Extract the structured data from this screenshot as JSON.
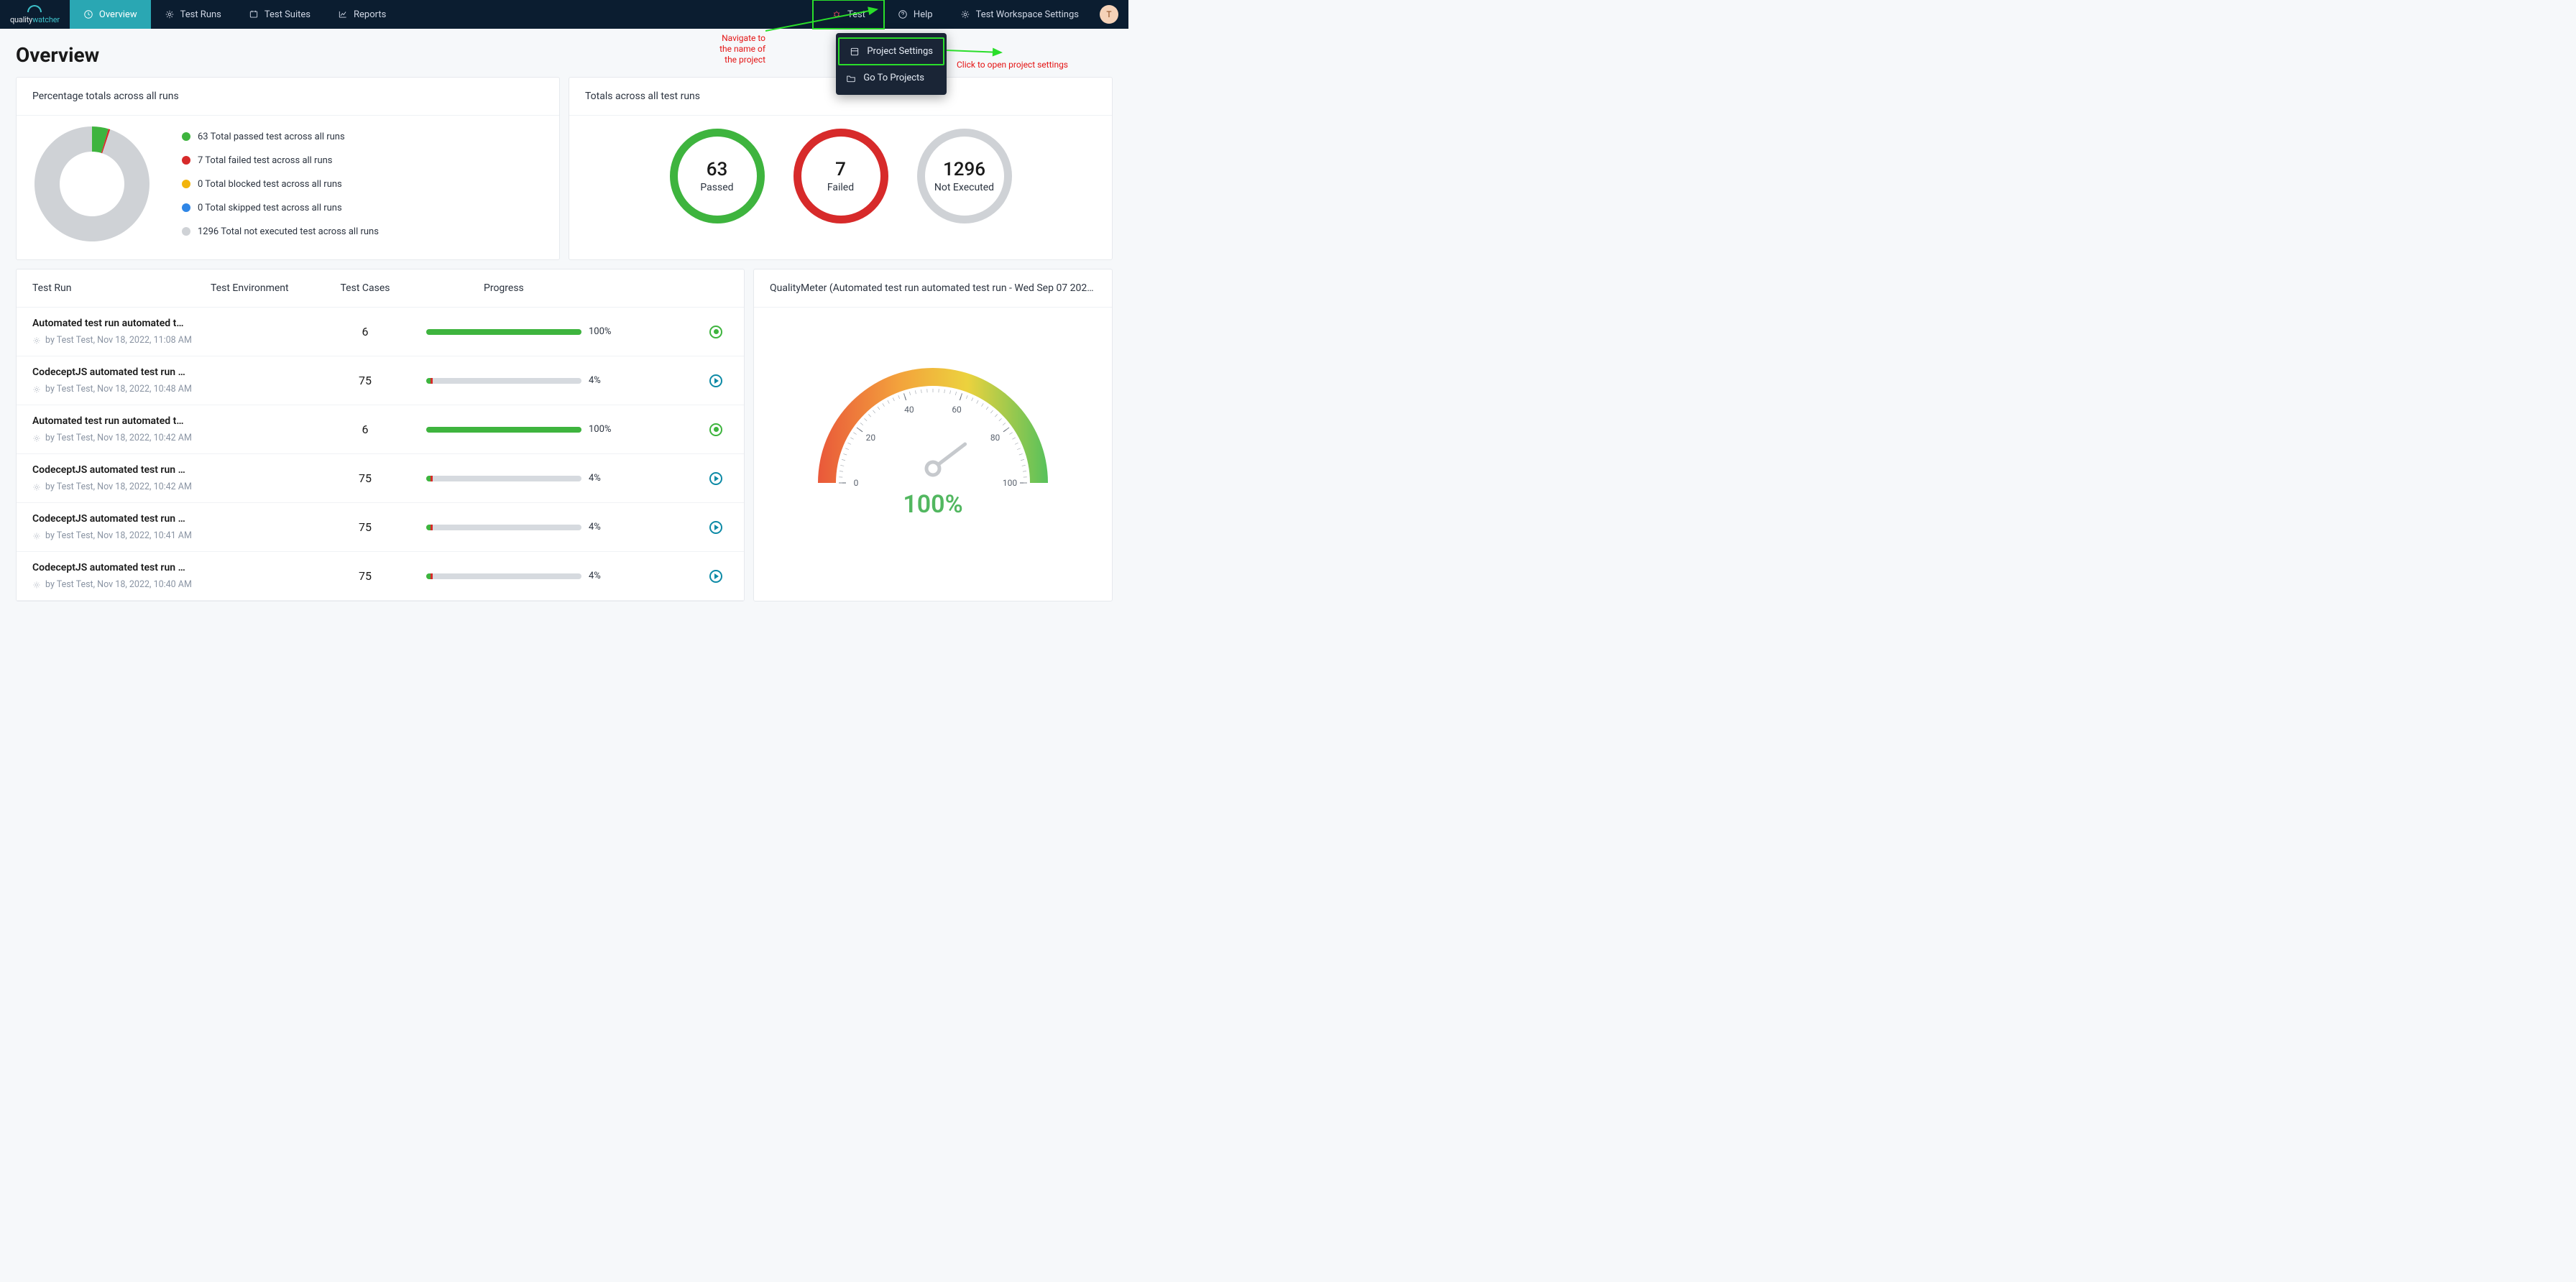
{
  "brand": {
    "name1": "quality",
    "name2": "watcher"
  },
  "nav": {
    "overview": "Overview",
    "runs": "Test Runs",
    "suites": "Test Suites",
    "reports": "Reports",
    "project": "Test",
    "help": "Help",
    "workspace": "Test Workspace Settings",
    "avatar_initial": "T"
  },
  "dropdown": {
    "project_settings": "Project Settings",
    "go_to_projects": "Go To Projects"
  },
  "annotations": {
    "left": "Navigate to\nthe name of\nthe project",
    "right": "Click to open project settings"
  },
  "page_title": "Overview",
  "percent_card": {
    "title": "Percentage totals across all runs"
  },
  "totals_card": {
    "title": "Totals across all test runs"
  },
  "chart_data": {
    "donut": {
      "type": "pie",
      "title": "Percentage totals across all runs",
      "series": [
        {
          "name": "passed",
          "value": 63,
          "color": "#3eb43e",
          "label": "63 Total passed test across all runs"
        },
        {
          "name": "failed",
          "value": 7,
          "color": "#d72a2a",
          "label": "7 Total failed test across all runs"
        },
        {
          "name": "blocked",
          "value": 0,
          "color": "#f2b40c",
          "label": "0 Total blocked test across all runs"
        },
        {
          "name": "skipped",
          "value": 0,
          "color": "#2f86e6",
          "label": "0 Total skipped test across all runs"
        },
        {
          "name": "not_executed",
          "value": 1296,
          "color": "#cfd2d6",
          "label": "1296 Total not executed test across all runs"
        }
      ]
    },
    "totals": [
      {
        "value": 63,
        "label": "Passed",
        "color": "#3eb43e"
      },
      {
        "value": 7,
        "label": "Failed",
        "color": "#d72a2a"
      },
      {
        "value": 1296,
        "label": "Not Executed",
        "color": "#cfd2d6"
      }
    ],
    "gauge": {
      "type": "gauge",
      "value": 100,
      "display": "100%",
      "min": 0,
      "max": 100,
      "ticks": [
        0,
        20,
        40,
        60,
        80,
        100
      ],
      "title": "QualityMeter (Automated test run automated test run - Wed Sep 07 202…"
    }
  },
  "table": {
    "cols": {
      "run": "Test Run",
      "env": "Test Environment",
      "cases": "Test Cases",
      "prog": "Progress"
    },
    "rows": [
      {
        "title": "Automated test run automated test …",
        "meta": "by Test Test, Nov 18, 2022, 11:08 AM",
        "cases": 6,
        "progress": 100,
        "pass_pct": 100,
        "fail_pct": 0,
        "status": "done"
      },
      {
        "title": "CodeceptJS automated test run - Fr…",
        "meta": "by Test Test, Nov 18, 2022, 10:48 AM",
        "cases": 75,
        "progress": 4,
        "pass_pct": 3,
        "fail_pct": 1,
        "status": "play"
      },
      {
        "title": "Automated test run automated test …",
        "meta": "by Test Test, Nov 18, 2022, 10:42 AM",
        "cases": 6,
        "progress": 100,
        "pass_pct": 100,
        "fail_pct": 0,
        "status": "done"
      },
      {
        "title": "CodeceptJS automated test run - Fr…",
        "meta": "by Test Test, Nov 18, 2022, 10:42 AM",
        "cases": 75,
        "progress": 4,
        "pass_pct": 3,
        "fail_pct": 1,
        "status": "play"
      },
      {
        "title": "CodeceptJS automated test run - Fr…",
        "meta": "by Test Test, Nov 18, 2022, 10:41 AM",
        "cases": 75,
        "progress": 4,
        "pass_pct": 3,
        "fail_pct": 1,
        "status": "play"
      },
      {
        "title": "CodeceptJS automated test run - Fr…",
        "meta": "by Test Test, Nov 18, 2022, 10:40 AM",
        "cases": 75,
        "progress": 4,
        "pass_pct": 3,
        "fail_pct": 1,
        "status": "play"
      }
    ]
  }
}
